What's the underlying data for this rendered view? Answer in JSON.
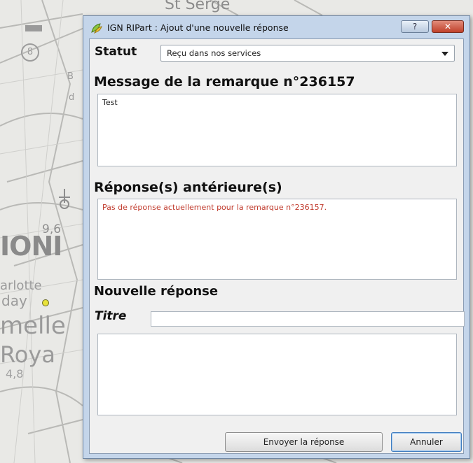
{
  "map": {
    "labels": {
      "top": "St Serge",
      "big": "IONI",
      "distance": "9,6",
      "city1": "arlotte",
      "city2": "day",
      "city3": "melle",
      "city4": "Roya",
      "distance2": "4,8",
      "letter_b": "B",
      "letter_d": "d",
      "circle": "8"
    }
  },
  "dialog": {
    "title": "IGN RIPart : Ajout d'une nouvelle réponse",
    "help_label": "?",
    "close_label": "✕",
    "statut": {
      "label": "Statut",
      "value": "Reçu dans nos services"
    },
    "message": {
      "label": "Message de la remarque n°236157",
      "text": "Test"
    },
    "previous": {
      "label": "Réponse(s) antérieure(s)",
      "text": "Pas de réponse actuellement pour la remarque n°236157."
    },
    "new_response": {
      "label": "Nouvelle réponse",
      "title_label": "Titre",
      "title_value": "",
      "body_value": ""
    },
    "buttons": {
      "send": "Envoyer la réponse",
      "cancel": "Annuler"
    }
  }
}
